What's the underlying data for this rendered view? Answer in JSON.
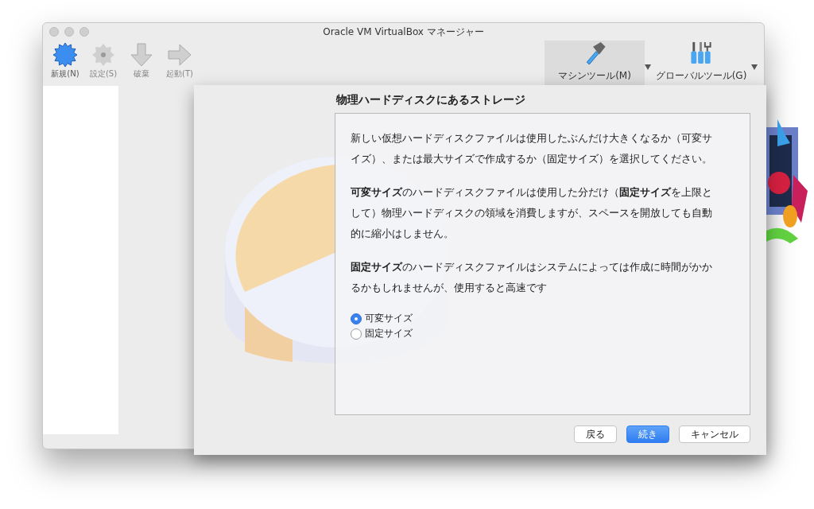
{
  "window": {
    "title": "Oracle VM VirtualBox マネージャー"
  },
  "toolbar": [
    {
      "label": "新規(N)",
      "kind": "new",
      "disabled": false
    },
    {
      "label": "設定(S)",
      "kind": "settings",
      "disabled": true
    },
    {
      "label": "破棄",
      "kind": "discard",
      "disabled": true
    },
    {
      "label": "起動(T)",
      "kind": "start",
      "disabled": true
    }
  ],
  "tool_buttons": [
    {
      "label": "マシンツール(M)",
      "kind": "machine",
      "selected": true
    },
    {
      "label": "グローバルツール(G)",
      "kind": "global",
      "selected": false
    }
  ],
  "dialog": {
    "title": "物理ハードディスクにあるストレージ",
    "paragraphs": [
      "新しい仮想ハードディスクファイルは使用したぶんだけ大きくなるか（可変サイズ）、または最大サイズで作成するか（固定サイズ）を選択してください。",
      "**可変サイズ**のハードディスクファイルは使用した分だけ（**固定サイズ**を上限として）物理ハードディスクの領域を消費しますが、スペースを開放しても自動的に縮小はしません。",
      "**固定サイズ**のハードディスクファイルはシステムによっては作成に時間がかかるかもしれませんが、使用すると高速です"
    ],
    "options": [
      {
        "label": "可変サイズ",
        "selected": true
      },
      {
        "label": "固定サイズ",
        "selected": false
      }
    ],
    "buttons": [
      {
        "label": "戻る",
        "kind": "default"
      },
      {
        "label": "続き",
        "kind": "primary"
      },
      {
        "label": "キャンセル",
        "kind": "default"
      }
    ]
  }
}
